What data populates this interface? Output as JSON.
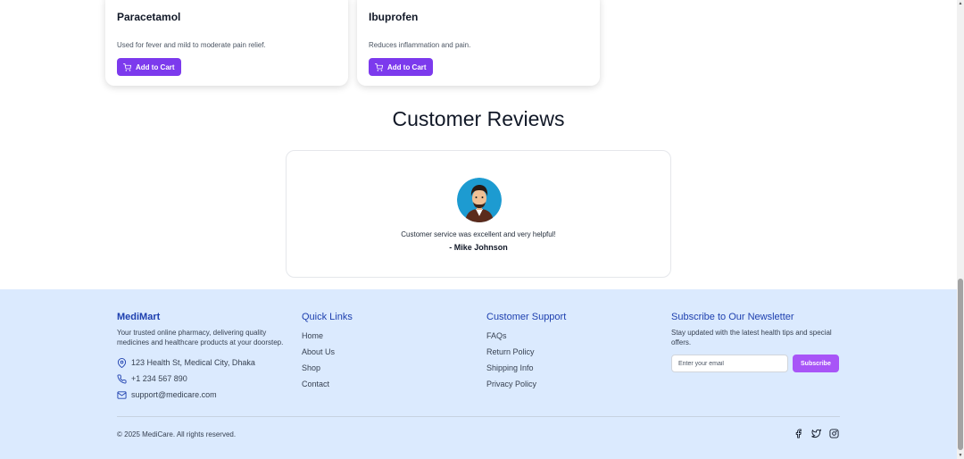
{
  "products": [
    {
      "name": "Paracetamol",
      "description": "Used for fever and mild to moderate pain relief.",
      "button_label": "Add to Cart"
    },
    {
      "name": "Ibuprofen",
      "description": "Reduces inflammation and pain.",
      "button_label": "Add to Cart"
    }
  ],
  "reviews": {
    "title": "Customer Reviews",
    "text": "Customer service was excellent and very helpful!",
    "author": "- Mike Johnson"
  },
  "footer": {
    "brand": "MediMart",
    "description": "Your trusted online pharmacy, delivering quality medicines and healthcare products at your doorstep.",
    "address": "123 Health St, Medical City, Dhaka",
    "phone": "+1 234 567 890",
    "email": "support@medicare.com",
    "quick_links": {
      "title": "Quick Links",
      "items": [
        "Home",
        "About Us",
        "Shop",
        "Contact"
      ]
    },
    "support": {
      "title": "Customer Support",
      "items": [
        "FAQs",
        "Return Policy",
        "Shipping Info",
        "Privacy Policy"
      ]
    },
    "newsletter": {
      "title": "Subscribe to Our Newsletter",
      "text": "Stay updated with the latest health tips and special offers.",
      "placeholder": "Enter your email",
      "button_label": "Subscribe"
    },
    "copyright": "© 2025 MediCare. All rights reserved.",
    "socials": [
      "facebook-icon",
      "twitter-icon",
      "instagram-icon"
    ]
  },
  "colors": {
    "primary_button": "#7c3aed",
    "subscribe_button": "#a855f7",
    "footer_bg": "#dbeafe",
    "footer_heading": "#1e40af"
  }
}
